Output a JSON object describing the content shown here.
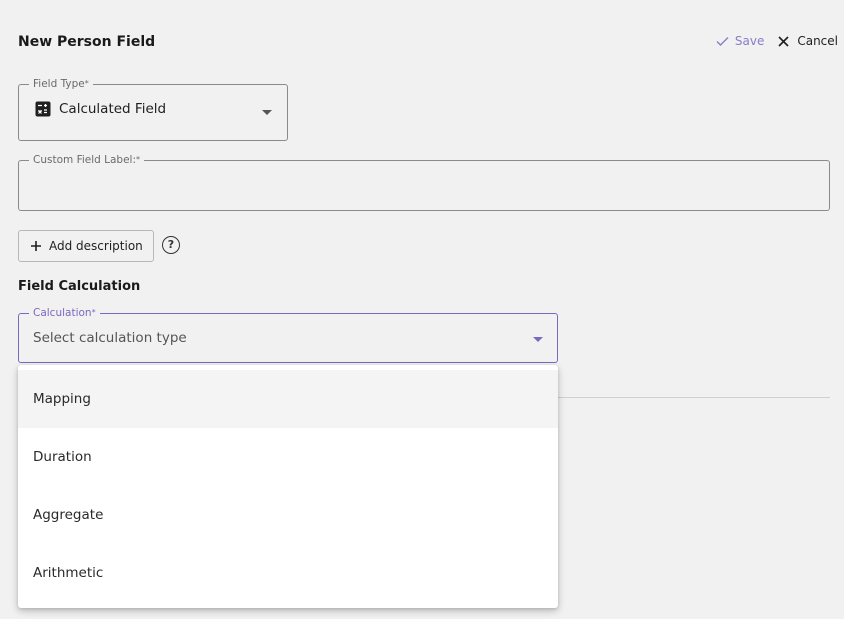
{
  "header": {
    "title": "New Person Field",
    "save_label": "Save",
    "cancel_label": "Cancel"
  },
  "field_type": {
    "label": "Field Type",
    "required_mark": "*",
    "value": "Calculated Field",
    "icon": "calculator-icon"
  },
  "custom_label": {
    "label": "Custom Field Label:",
    "required_mark": "*",
    "value": ""
  },
  "add_description": {
    "label": "Add description"
  },
  "help": {
    "symbol": "?"
  },
  "section": {
    "title": "Field Calculation"
  },
  "calculation": {
    "label": "Calculation",
    "required_mark": "*",
    "placeholder": "Select calculation type",
    "options": [
      "Mapping",
      "Duration",
      "Aggregate",
      "Arithmetic"
    ],
    "highlighted": "Mapping"
  },
  "colors": {
    "accent": "#7b68c0",
    "save": "#8b7bc9",
    "background": "#f1f1f1"
  }
}
